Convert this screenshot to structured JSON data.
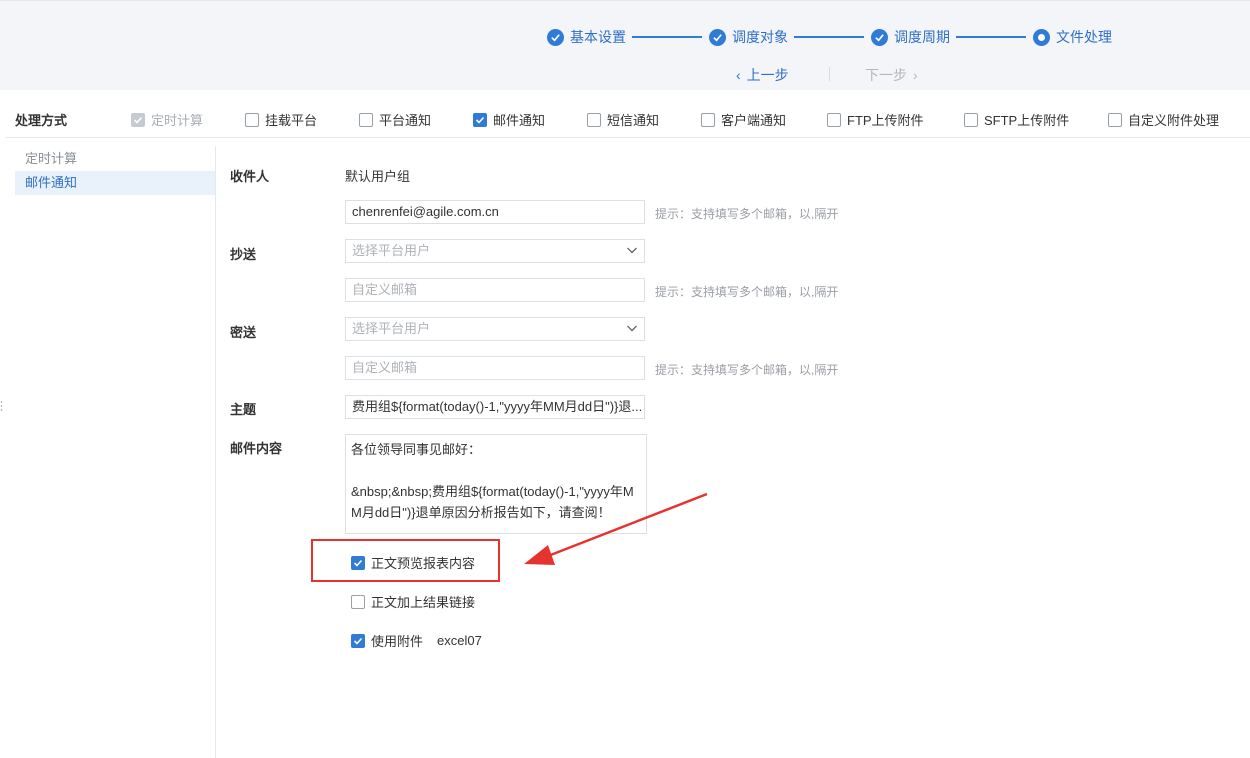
{
  "steps": [
    {
      "label": "基本设置",
      "state": "done"
    },
    {
      "label": "调度对象",
      "state": "done"
    },
    {
      "label": "调度周期",
      "state": "done"
    },
    {
      "label": "文件处理",
      "state": "current"
    }
  ],
  "nav": {
    "prev": "上一步",
    "next": "下一步"
  },
  "processing": {
    "title": "处理方式",
    "options": [
      {
        "label": "定时计算",
        "checked": true,
        "disabled": true
      },
      {
        "label": "挂载平台",
        "checked": false
      },
      {
        "label": "平台通知",
        "checked": false
      },
      {
        "label": "邮件通知",
        "checked": true
      },
      {
        "label": "短信通知",
        "checked": false
      },
      {
        "label": "客户端通知",
        "checked": false
      },
      {
        "label": "FTP上传附件",
        "checked": false
      },
      {
        "label": "SFTP上传附件",
        "checked": false
      },
      {
        "label": "自定义附件处理",
        "checked": false
      }
    ]
  },
  "side": {
    "items": [
      {
        "label": "定时计算",
        "active": false
      },
      {
        "label": "邮件通知",
        "active": true
      }
    ]
  },
  "form": {
    "recipient_label": "收件人",
    "recipient_group": "默认用户组",
    "recipient_email": "chenrenfei@agile.com.cn",
    "hint": "提示：支持填写多个邮箱，以,隔开",
    "cc_label": "抄送",
    "cc_select_placeholder": "选择平台用户",
    "cc_custom_placeholder": "自定义邮箱",
    "bcc_label": "密送",
    "bcc_select_placeholder": "选择平台用户",
    "bcc_custom_placeholder": "自定义邮箱",
    "subject_label": "主题",
    "subject_value": "费用组${format(today()-1,\"yyyy年MM月dd日\")}退...",
    "content_label": "邮件内容",
    "content_lines": [
      "各位领导同事见邮好：",
      "",
      "&nbsp;&nbsp;费用组${format(today()-1,\"yyyy年M",
      "M月dd日\")}退单原因分析报告如下，请查阅！"
    ],
    "options": [
      {
        "label": "正文预览报表内容",
        "checked": true
      },
      {
        "label": "正文加上结果链接",
        "checked": false
      },
      {
        "label": "使用附件",
        "checked": true,
        "suffix": "excel07"
      }
    ]
  },
  "colors": {
    "accent": "#2f7bd6",
    "annotation": "#e5342e"
  }
}
